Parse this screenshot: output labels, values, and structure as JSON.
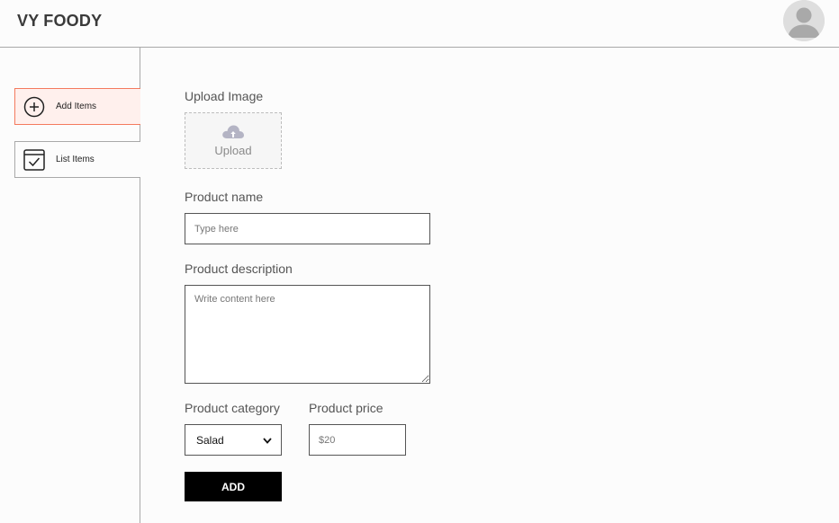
{
  "navbar": {
    "logo": "VY FOODY",
    "avatar_icon": "user-avatar-icon"
  },
  "sidebar": {
    "items": [
      {
        "label": "Add Items",
        "icon": "add-circle-icon",
        "active": true
      },
      {
        "label": "List Items",
        "icon": "checklist-icon",
        "active": false
      }
    ]
  },
  "form": {
    "upload": {
      "label": "Upload Image",
      "button_text": "Upload",
      "icon": "cloud-upload-icon"
    },
    "name": {
      "label": "Product name",
      "placeholder": "Type here",
      "value": ""
    },
    "description": {
      "label": "Product description",
      "placeholder": "Write content here",
      "value": ""
    },
    "category": {
      "label": "Product category",
      "selected": "Salad"
    },
    "price": {
      "label": "Product price",
      "placeholder": "$20",
      "value": ""
    },
    "submit_label": "ADD"
  },
  "colors": {
    "active_bg": "#fff0ed",
    "active_border": "#f47a5e",
    "button_bg": "#000000"
  }
}
